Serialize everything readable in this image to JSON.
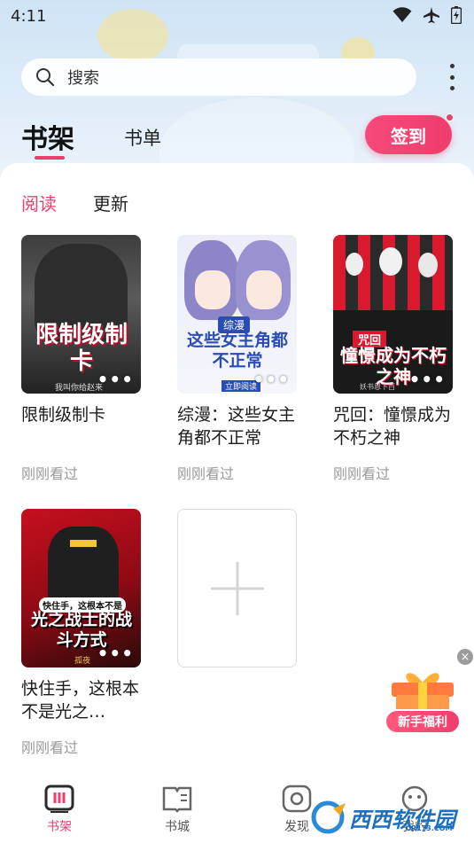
{
  "status_bar": {
    "time": "4:11"
  },
  "search": {
    "placeholder": "搜索"
  },
  "tabs": {
    "shelf": "书架",
    "list": "书单"
  },
  "checkin": {
    "label": "签到"
  },
  "sub_tabs": {
    "read": "阅读",
    "update": "更新"
  },
  "books": [
    {
      "title": "限制级制卡",
      "status": "刚刚看过",
      "cover_text": "限制级制卡",
      "cover_sub": "我叫你给赵来"
    },
    {
      "title": "综漫：这些女主角都不正常",
      "status": "刚刚看过",
      "cover_text": "这些女主角都不正常",
      "cover_tag": "综漫",
      "cover_sub": "立即阅读"
    },
    {
      "title": "咒回：憧憬成为不朽之神",
      "status": "刚刚看过",
      "cover_text": "憧憬成为不朽之神",
      "cover_tag": "咒回",
      "cover_sub": "妖书恩下百"
    },
    {
      "title": "快住手，这根本不是光之…",
      "status": "刚刚看过",
      "cover_text": "光之战士的战斗方式",
      "cover_tag": "快住手，这根本不是",
      "cover_sub": "孤夜"
    }
  ],
  "gift": {
    "label": "新手福利"
  },
  "nav": [
    {
      "label": "书架",
      "icon": "bookshelf-icon"
    },
    {
      "label": "书城",
      "icon": "open-book-icon"
    },
    {
      "label": "发现",
      "icon": "discover-icon"
    },
    {
      "label": "我的",
      "icon": "profile-icon"
    }
  ],
  "watermark": {
    "text": "西西软件园",
    "sub": "CR173.COM"
  },
  "colors": {
    "accent": "#ef3d6e",
    "header_bg": "#d6e8f7",
    "muted": "#9a9a9a"
  }
}
